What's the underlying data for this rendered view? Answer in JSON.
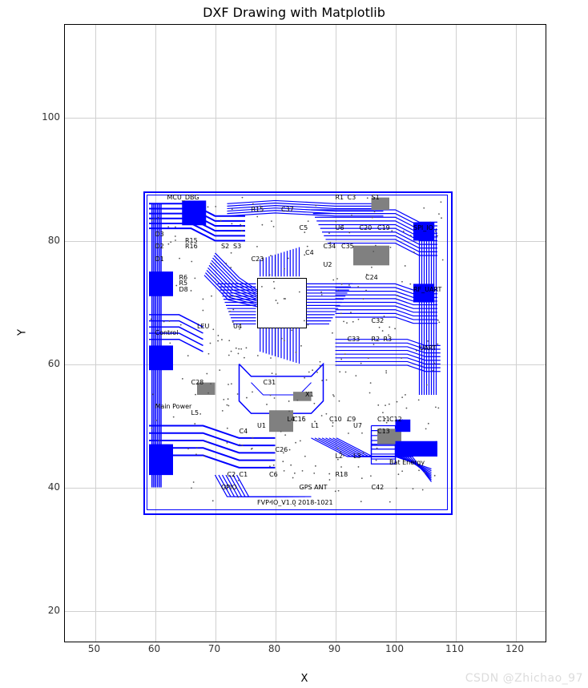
{
  "chart_data": {
    "type": "scatter",
    "title": "DXF Drawing with Matplotlib",
    "xlabel": "X",
    "ylabel": "Y",
    "xlim": [
      45,
      125
    ],
    "ylim": [
      15,
      115
    ],
    "xticks": [
      50,
      60,
      70,
      80,
      90,
      100,
      110,
      120
    ],
    "yticks": [
      20,
      40,
      60,
      80,
      100
    ],
    "grid": true,
    "pcb_outline": {
      "x": 58,
      "y": 36,
      "w": 51,
      "h": 52
    },
    "ic_main": {
      "x": 77,
      "y": 66,
      "w": 8,
      "h": 8
    },
    "labels": [
      {
        "text": "MCU_DBG",
        "x": 62,
        "y": 87
      },
      {
        "text": "D3",
        "x": 60,
        "y": 81
      },
      {
        "text": "R15",
        "x": 76,
        "y": 85
      },
      {
        "text": "C37",
        "x": 81,
        "y": 85
      },
      {
        "text": "R1",
        "x": 90,
        "y": 87
      },
      {
        "text": "C3",
        "x": 92,
        "y": 87
      },
      {
        "text": "S1",
        "x": 96,
        "y": 87
      },
      {
        "text": "C5",
        "x": 84,
        "y": 82
      },
      {
        "text": "U6",
        "x": 90,
        "y": 82
      },
      {
        "text": "C20",
        "x": 94,
        "y": 82
      },
      {
        "text": "C19",
        "x": 97,
        "y": 82
      },
      {
        "text": "SPI_IO",
        "x": 103,
        "y": 82
      },
      {
        "text": "R15",
        "x": 65,
        "y": 80
      },
      {
        "text": "R16",
        "x": 65,
        "y": 79
      },
      {
        "text": "D2",
        "x": 60,
        "y": 79
      },
      {
        "text": "S2",
        "x": 71,
        "y": 79
      },
      {
        "text": "S3",
        "x": 73,
        "y": 79
      },
      {
        "text": "C34",
        "x": 88,
        "y": 79
      },
      {
        "text": "C35",
        "x": 91,
        "y": 79
      },
      {
        "text": "D1",
        "x": 60,
        "y": 77
      },
      {
        "text": "C4",
        "x": 85,
        "y": 78
      },
      {
        "text": "U2",
        "x": 88,
        "y": 76
      },
      {
        "text": "C23",
        "x": 76,
        "y": 77
      },
      {
        "text": "C24",
        "x": 95,
        "y": 74
      },
      {
        "text": "R6",
        "x": 64,
        "y": 74
      },
      {
        "text": "R5",
        "x": 64,
        "y": 73
      },
      {
        "text": "D8",
        "x": 64,
        "y": 72
      },
      {
        "text": "RF_UART",
        "x": 103,
        "y": 72
      },
      {
        "text": "LEU",
        "x": 67,
        "y": 66
      },
      {
        "text": "Control",
        "x": 60,
        "y": 65
      },
      {
        "text": "U4",
        "x": 73,
        "y": 66
      },
      {
        "text": "C32",
        "x": 96,
        "y": 67
      },
      {
        "text": "C33",
        "x": 92,
        "y": 64
      },
      {
        "text": "R2",
        "x": 96,
        "y": 64
      },
      {
        "text": "R3",
        "x": 98,
        "y": 64
      },
      {
        "text": "UART",
        "x": 104,
        "y": 62.5
      },
      {
        "text": "C28",
        "x": 66,
        "y": 57
      },
      {
        "text": "C31",
        "x": 78,
        "y": 57
      },
      {
        "text": "X1",
        "x": 85,
        "y": 55
      },
      {
        "text": "Main Power",
        "x": 60,
        "y": 53
      },
      {
        "text": "L5",
        "x": 66,
        "y": 52
      },
      {
        "text": "C16",
        "x": 83,
        "y": 51
      },
      {
        "text": "L4",
        "x": 82,
        "y": 51
      },
      {
        "text": "C10",
        "x": 89,
        "y": 51
      },
      {
        "text": "C9",
        "x": 92,
        "y": 51
      },
      {
        "text": "C11",
        "x": 97,
        "y": 51
      },
      {
        "text": "C12",
        "x": 99,
        "y": 51
      },
      {
        "text": "U1",
        "x": 77,
        "y": 50
      },
      {
        "text": "L1",
        "x": 86,
        "y": 50
      },
      {
        "text": "U7",
        "x": 93,
        "y": 50
      },
      {
        "text": "C13",
        "x": 97,
        "y": 49
      },
      {
        "text": "C4",
        "x": 74,
        "y": 49
      },
      {
        "text": "C26",
        "x": 80,
        "y": 46
      },
      {
        "text": "L2",
        "x": 90,
        "y": 45
      },
      {
        "text": "L3",
        "x": 93,
        "y": 45
      },
      {
        "text": "Bat Energy",
        "x": 99,
        "y": 44
      },
      {
        "text": "C2",
        "x": 72,
        "y": 42
      },
      {
        "text": "C1",
        "x": 74,
        "y": 42
      },
      {
        "text": "C6",
        "x": 79,
        "y": 42
      },
      {
        "text": "R18",
        "x": 90,
        "y": 42
      },
      {
        "text": "GPIO",
        "x": 71,
        "y": 40
      },
      {
        "text": "GPS ANT",
        "x": 84,
        "y": 40
      },
      {
        "text": "C42",
        "x": 96,
        "y": 40
      },
      {
        "text": "FVP-IO_V1.0   2018-1021",
        "x": 77,
        "y": 37.5
      }
    ]
  },
  "watermark": "CSDN @Zhichao_97"
}
